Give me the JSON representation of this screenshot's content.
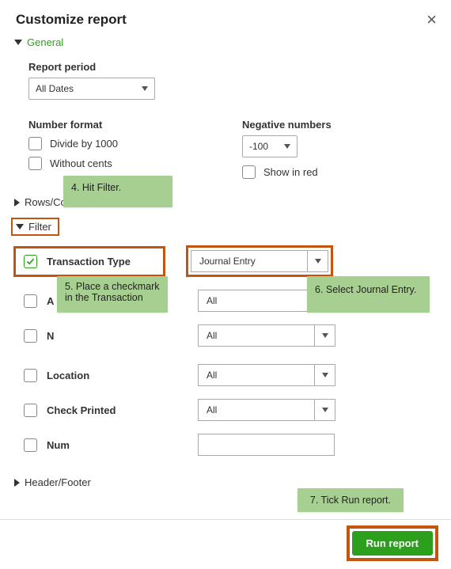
{
  "title": "Customize report",
  "sections": {
    "general": "General",
    "rows": "Rows/Columns",
    "filter": "Filter",
    "header": "Header/Footer"
  },
  "general": {
    "report_period_label": "Report period",
    "report_period_value": "All Dates",
    "number_format_label": "Number format",
    "divide_label": "Divide by 1000",
    "without_cents_label": "Without cents",
    "negative_label": "Negative numbers",
    "negative_value": "-100",
    "show_red_label": "Show in red"
  },
  "filters": {
    "transaction_type": {
      "label": "Transaction Type",
      "value": "Journal Entry",
      "checked": true
    },
    "account": {
      "label": "A",
      "value": "All"
    },
    "name": {
      "label": "N",
      "value": "All"
    },
    "location": {
      "label": "Location",
      "value": "All"
    },
    "check_printed": {
      "label": "Check Printed",
      "value": "All"
    },
    "num": {
      "label": "Num",
      "value": ""
    }
  },
  "tips": {
    "t4": "4. Hit Filter.",
    "t5": "5. Place a checkmark in the Transaction",
    "t6": "6. Select Journal Entry.",
    "t7": "7. Tick Run report."
  },
  "run_label": "Run report"
}
